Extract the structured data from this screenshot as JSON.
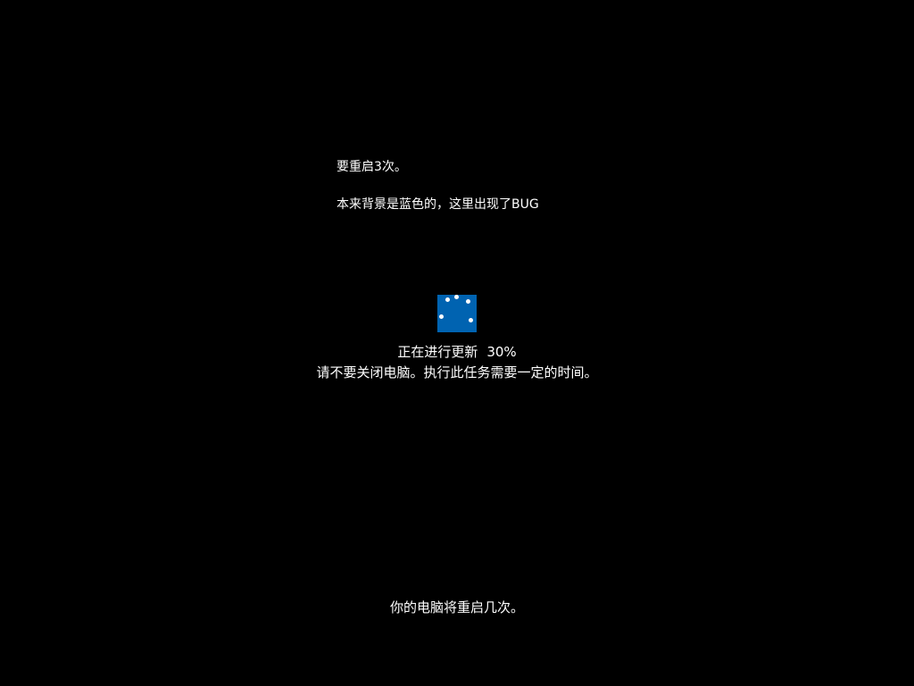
{
  "annotations": {
    "line1": "要重启3次。",
    "line2": "本来背景是蓝色的，这里出现了BUG"
  },
  "update": {
    "status_label": "正在进行更新",
    "progress_text": "30%",
    "progress": 0.3,
    "warning": "请不要关闭电脑。执行此任务需要一定的时间。",
    "restart_notice": "你的电脑将重启几次。"
  },
  "colors": {
    "background": "#000000",
    "spinner_box": "#0063b1",
    "text": "#ffffff"
  },
  "icons": {
    "spinner": "loading-dots-spinner"
  }
}
